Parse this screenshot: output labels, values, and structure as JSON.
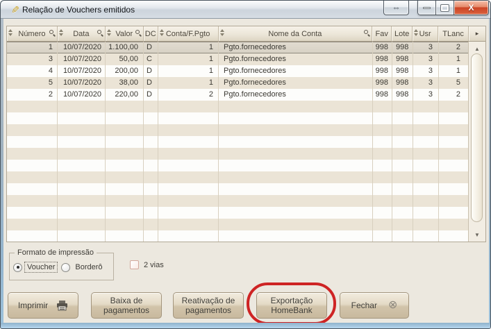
{
  "window": {
    "title": "Relação de Vouchers emitidos",
    "titlebar_icons": {
      "app": "hand-pen-icon",
      "restore_glyph": "⇔",
      "close_glyph": "X"
    }
  },
  "grid": {
    "columns": [
      {
        "key": "numero",
        "label": "Número",
        "sort": true,
        "filter": true
      },
      {
        "key": "data",
        "label": "Data",
        "sort": true,
        "filter": true
      },
      {
        "key": "valor",
        "label": "Valor",
        "sort": true,
        "filter": true
      },
      {
        "key": "dc",
        "label": "DC",
        "sort": false,
        "filter": false
      },
      {
        "key": "conta",
        "label": "Conta/F.Pgto",
        "sort": true,
        "filter": false
      },
      {
        "key": "nome",
        "label": "Nome da Conta",
        "sort": true,
        "filter": true
      },
      {
        "key": "fav",
        "label": "Fav",
        "sort": false,
        "filter": false
      },
      {
        "key": "lote",
        "label": "Lote",
        "sort": false,
        "filter": false
      },
      {
        "key": "usr",
        "label": "Usr",
        "sort": true,
        "filter": false
      },
      {
        "key": "tlanc",
        "label": "TLanc",
        "sort": false,
        "filter": false
      }
    ],
    "nav_arrow": "▸",
    "rows": [
      {
        "cells": [
          "1",
          "10/07/2020",
          "1.100,00",
          "D",
          "1",
          "Pgto.fornecedores",
          "998",
          "998",
          "3",
          "2"
        ],
        "selected": true
      },
      {
        "cells": [
          "3",
          "10/07/2020",
          "50,00",
          "C",
          "1",
          "Pgto.fornecedores",
          "998",
          "998",
          "3",
          "1"
        ],
        "selected": false
      },
      {
        "cells": [
          "4",
          "10/07/2020",
          "200,00",
          "D",
          "1",
          "Pgto.fornecedores",
          "998",
          "998",
          "3",
          "1"
        ],
        "selected": false
      },
      {
        "cells": [
          "5",
          "10/07/2020",
          "38,00",
          "D",
          "1",
          "Pgto.fornecedores",
          "998",
          "998",
          "3",
          "5"
        ],
        "selected": false
      },
      {
        "cells": [
          "2",
          "10/07/2020",
          "220,00",
          "D",
          "2",
          "Pgto.fornecedores",
          "998",
          "998",
          "3",
          "2"
        ],
        "selected": false
      }
    ],
    "empty_rows": 12,
    "scrollbar": {
      "up_glyph": "▲",
      "down_glyph": "▼"
    }
  },
  "print_format": {
    "legend": "Formato de impressão",
    "options": [
      {
        "label": "Voucher",
        "selected": true
      },
      {
        "label": "Borderô",
        "selected": false
      }
    ],
    "copies_checkbox": {
      "label": "2 vias",
      "checked": false
    }
  },
  "action_buttons": {
    "imprimir": {
      "label": "Imprimir"
    },
    "baixa": {
      "label": "Baixa de\npagamentos"
    },
    "reativacao": {
      "label": "Reativação de\npagamentos"
    },
    "exportacao": {
      "label": "Exportação\nHomeBank",
      "annotated": true
    },
    "fechar": {
      "label": "Fechar",
      "icon_glyph": "⊗"
    }
  },
  "colors": {
    "form_background": "#ece8df",
    "row_beige": "#ebe4d6",
    "row_white": "#fdfdfb",
    "selected_row": "#d9d3c6",
    "button_face": "#d9cdb6",
    "annotation_red": "#ce2424",
    "close_button_red": "#cc4526"
  }
}
